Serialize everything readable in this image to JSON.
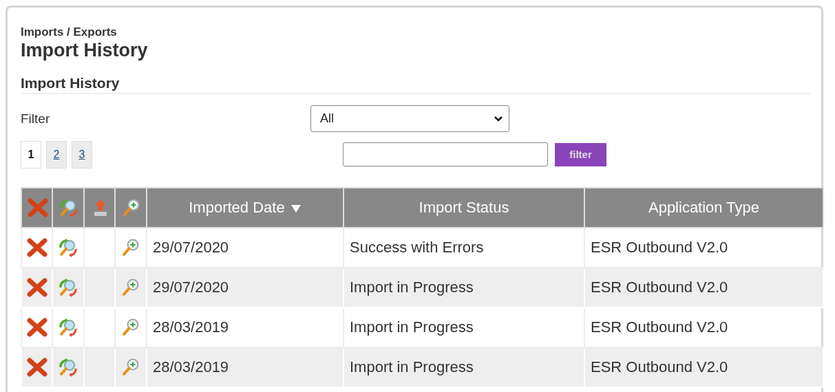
{
  "breadcrumb": "Imports / Exports",
  "title": "Import History",
  "section_title": "Import History",
  "filter": {
    "label": "Filter",
    "value": "All"
  },
  "pages": [
    {
      "label": "1",
      "selected": true
    },
    {
      "label": "2",
      "selected": false
    },
    {
      "label": "3",
      "selected": false
    }
  ],
  "search": {
    "button": "filter"
  },
  "table": {
    "icon_columns": [
      {
        "kind": "delete"
      },
      {
        "kind": "reprocess"
      },
      {
        "kind": "upload"
      },
      {
        "kind": "view"
      }
    ],
    "columns": [
      {
        "label": "Imported Date",
        "sorted": true
      },
      {
        "label": "Import Status",
        "sorted": false
      },
      {
        "label": "Application Type",
        "sorted": false
      }
    ],
    "rows": [
      {
        "actions": [
          {
            "kind": "delete"
          },
          {
            "kind": "reprocess"
          },
          {
            "kind": "empty"
          },
          {
            "kind": "view"
          }
        ],
        "cells": [
          "29/07/2020",
          "Success with Errors",
          "ESR Outbound V2.0"
        ]
      },
      {
        "actions": [
          {
            "kind": "delete"
          },
          {
            "kind": "reprocess"
          },
          {
            "kind": "empty"
          },
          {
            "kind": "view"
          }
        ],
        "cells": [
          "29/07/2020",
          "Import in Progress",
          "ESR Outbound V2.0"
        ]
      },
      {
        "actions": [
          {
            "kind": "delete"
          },
          {
            "kind": "reprocess"
          },
          {
            "kind": "empty"
          },
          {
            "kind": "view"
          }
        ],
        "cells": [
          "28/03/2019",
          "Import in Progress",
          "ESR Outbound V2.0"
        ]
      },
      {
        "actions": [
          {
            "kind": "delete"
          },
          {
            "kind": "reprocess"
          },
          {
            "kind": "empty"
          },
          {
            "kind": "view"
          }
        ],
        "cells": [
          "28/03/2019",
          "Import in Progress",
          "ESR Outbound V2.0"
        ]
      }
    ]
  }
}
